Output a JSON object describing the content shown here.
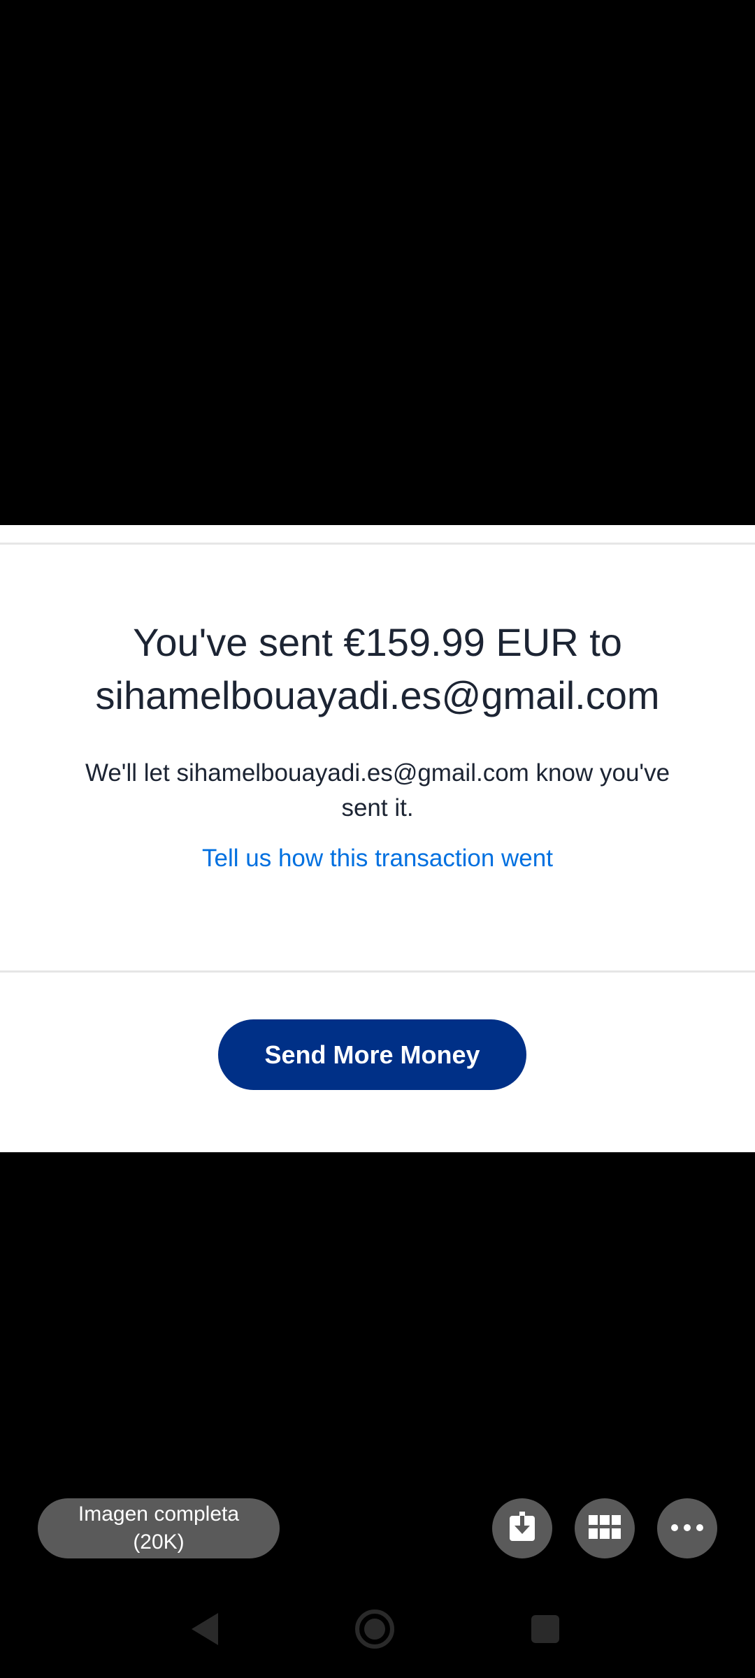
{
  "confirmation": {
    "headline_line1": "You've sent €159.99 EUR to",
    "headline_line2": "sihamelbouayadi.es@gmail.com",
    "notice_line1": "We'll let sihamelbouayadi.es@gmail.com know you've",
    "notice_line2": "sent it.",
    "feedback_link": "Tell us how this transaction went",
    "send_more_button": "Send More Money"
  },
  "viewer": {
    "chip_line1": "Imagen completa",
    "chip_line2": "(20K)",
    "actions": [
      {
        "name": "download-icon"
      },
      {
        "name": "grid-icon"
      },
      {
        "name": "more-options-icon"
      }
    ]
  },
  "navigation": {
    "icons": [
      "back-icon",
      "home-icon",
      "recents-icon"
    ]
  },
  "colors": {
    "button_bg": "#003087",
    "link": "#0070e0",
    "text": "#1c2433",
    "chip_bg": "#5a5a5a"
  }
}
